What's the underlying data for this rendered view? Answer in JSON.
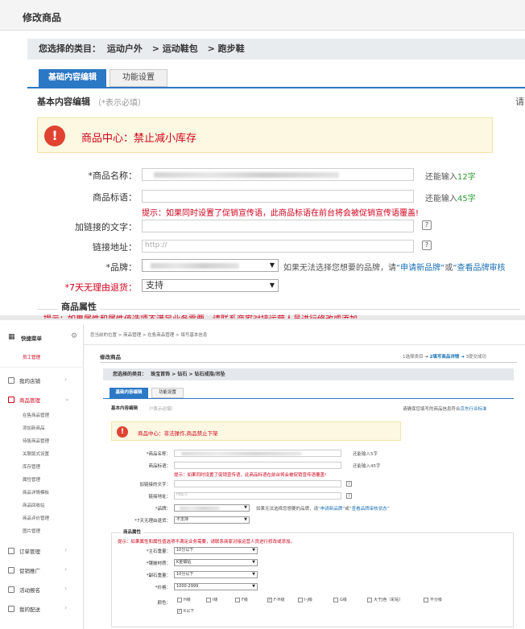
{
  "top": {
    "page_title": "修改商品",
    "breadcrumb_prefix": "您选择的类目：",
    "categories": [
      "运动户外",
      "运动鞋包",
      "跑步鞋"
    ],
    "tabs": [
      "基础内容编辑",
      "功能设置"
    ],
    "section_title": "基本内容编辑",
    "required_note": "（*表示必填）",
    "alert_text": "商品中心：禁止减小库存",
    "fields": {
      "name_label": "*商品名称：",
      "name_hint_prefix": "还能输入",
      "name_hint_count": "12字",
      "slogan_label": "商品标语：",
      "slogan_hint_prefix": "还能输入",
      "slogan_hint_count": "45字",
      "tip": "提示：如果同时设置了促销宣传语，此商品标语在前台将会被促销宣传语覆盖!",
      "link_text_label": "加链接的文字：",
      "link_url_label": "链接地址：",
      "link_url_placeholder": "http://",
      "brand_label": "*品牌：",
      "brand_hint_a": "如果无法选择您想要的品牌，请",
      "brand_link1": "“申请新品牌”",
      "brand_or": "或",
      "brand_link2": "“查看品牌审核",
      "return_label": "*7天无理由退货：",
      "return_value": "支持"
    },
    "attr_section_title": "商品属性",
    "attr_tip": "提示：如果属性和属性值选项不满足业务需要，请联系商家对接运营人员进行修改或添加。"
  },
  "bottom": {
    "quick_menu": "快捷菜单",
    "staff_manage": "员工管理",
    "topbar_breadcrumb": [
      "您当前的位置",
      "商品管理",
      "在售商品管理",
      "填写基本信息"
    ],
    "page_title": "修改商品",
    "steps": [
      "1选择类目",
      "2填写商品详情",
      "3提交成功"
    ],
    "sidebar": [
      {
        "label": "我的店铺"
      },
      {
        "label": "商品管理"
      },
      {
        "label": "订单管理"
      },
      {
        "label": "促销推广"
      },
      {
        "label": "活动报名"
      },
      {
        "label": "我的配送"
      }
    ],
    "sub_items": [
      "在售商品管理",
      "添加新商品",
      "待售商品管理",
      "关联版式设置",
      "库存管理",
      "属性管理",
      "商品详情模板",
      "商品回收站",
      "商品评价管理",
      "图片管理"
    ],
    "breadcrumb_prefix": "您选择的类目：",
    "categories": [
      "珠宝首饰",
      "钻石",
      "钻石戒指/吊坠"
    ],
    "tabs": [
      "基础内容编辑",
      "功能设置"
    ],
    "section_title": "基本内容编辑",
    "required_note": "（*表示必填）",
    "right_note": "请确保您填写的商品信息符合",
    "right_note_link": "京东行业标准",
    "alert_text": "商品中心：非法操作,商品禁止下架",
    "fields": {
      "name_label": "*商品名称：",
      "name_hint": "还能输入5字",
      "slogan_label": "商品标语：",
      "slogan_hint": "还能输入45字",
      "tip": "提示：如果同时设置了促销宣传语，此商品标语在前台将会被促销宣传语覆盖!",
      "link_text_label": "加链接的文字：",
      "link_url_label": "链接地址：",
      "link_url_placeholder": "http://",
      "brand_label": "*品牌：",
      "brand_hint": "如果无法选择您想要的品牌，请",
      "brand_link1": "“申请新品牌”",
      "brand_or": "或",
      "brand_link2": "“查看品牌审核状态”",
      "return_label": "*7天无理由退货：",
      "return_value": "不支持"
    },
    "attr_section_title": "商品属性",
    "attr_tip": "提示：如果属性和属性值选项不满足业务需要，请联系商家对接运营人员进行修改或添加。",
    "attrs": [
      {
        "label": "*主石重量：",
        "value": "10分以下"
      },
      {
        "label": "*镶嵌材质：",
        "value": "K金镶钻"
      },
      {
        "label": "*副石重量：",
        "value": "10分以下"
      },
      {
        "label": "*价格：",
        "value": "1000-2999"
      }
    ],
    "color_label": "颜色：",
    "colors": [
      {
        "label": "H级",
        "checked": false
      },
      {
        "label": "I级",
        "checked": false
      },
      {
        "label": "F级",
        "checked": false
      },
      {
        "label": "F-H级",
        "checked": true
      },
      {
        "label": "I-J级",
        "checked": false
      },
      {
        "label": "G级",
        "checked": false
      },
      {
        "label": "大于J色（彩钻）",
        "checked": false
      },
      {
        "label": "不分级",
        "checked": false
      },
      {
        "label": "K以下",
        "checked": true
      }
    ]
  }
}
